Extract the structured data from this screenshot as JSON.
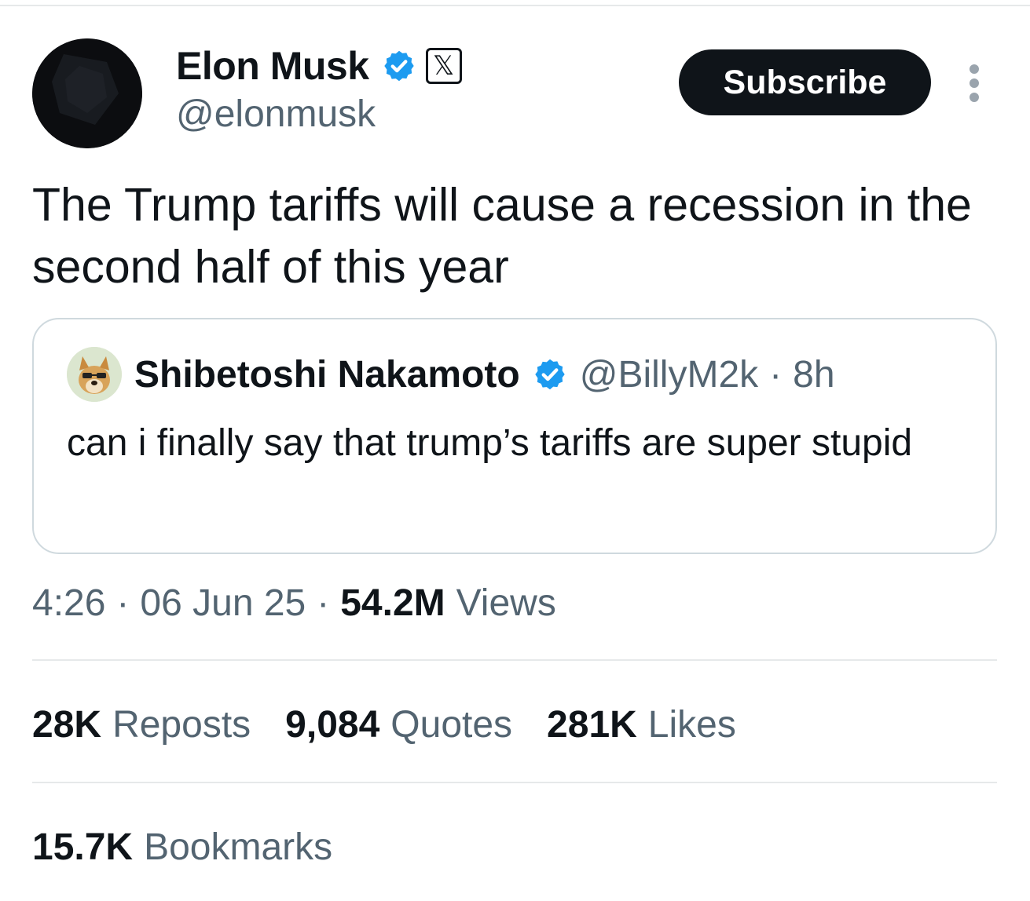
{
  "author": {
    "name": "Elon Musk",
    "handle": "@elonmusk",
    "affiliate_badge_glyph": "𝕏"
  },
  "header": {
    "subscribe_label": "Subscribe",
    "more_icon": "more-vertical-icon"
  },
  "tweet": {
    "text": "The Trump tariffs will cause a recession in the second half of this year"
  },
  "quoted_tweet": {
    "author_name": "Shibetoshi Nakamoto",
    "author_handle": "@BillyM2k",
    "separator": "·",
    "age": "8h",
    "text": "can i finally say that trump’s tariffs are super stupid"
  },
  "meta": {
    "time": "4:26",
    "separator": "·",
    "date": "06 Jun 25",
    "views_count": "54.2M",
    "views_label": "Views"
  },
  "stats": [
    {
      "count": "28K",
      "label": "Reposts"
    },
    {
      "count": "9,084",
      "label": "Quotes"
    },
    {
      "count": "281K",
      "label": "Likes"
    }
  ],
  "bookmarks": {
    "count": "15.7K",
    "label": "Bookmarks"
  },
  "colors": {
    "text_primary": "#0f1419",
    "text_secondary": "#536471",
    "verified_blue": "#1d9bf0",
    "border": "#cfd9de",
    "divider": "#e6e9ea"
  },
  "icons": {
    "verified": "verified-badge-icon",
    "affiliate": "x-logo-icon",
    "more": "more-vertical-icon"
  }
}
